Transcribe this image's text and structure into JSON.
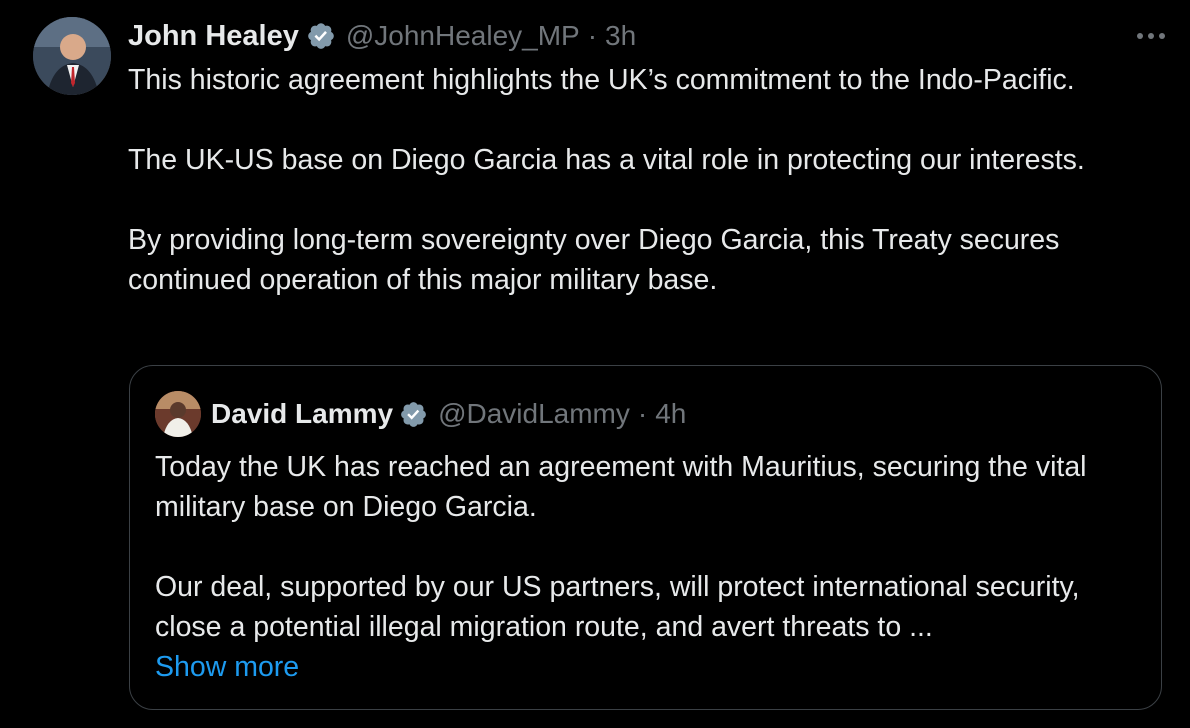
{
  "tweet": {
    "author": {
      "name": "John Healey",
      "handle": "@JohnHealey_MP",
      "separator": "·",
      "time": "3h",
      "verified": true
    },
    "paragraphs": [
      "This historic agreement highlights the UK’s commitment to the Indo-Pacific.",
      "The UK-US base on Diego Garcia has a vital role in protecting our interests.",
      "By providing long-term sovereignty over Diego Garcia, this Treaty secures continued operation of this major military base."
    ],
    "more_icon": "more-horizontal-icon"
  },
  "quoted_tweet": {
    "author": {
      "name": "David Lammy",
      "handle": "@DavidLammy",
      "separator": "·",
      "time": "4h",
      "verified": true
    },
    "paragraphs": [
      "Today the UK has reached an agreement with Mauritius, securing the vital military base on Diego Garcia.",
      "Our deal, supported by our US partners, will protect international security, close a potential illegal migration route, and avert threats to ..."
    ],
    "show_more_label": "Show more"
  },
  "colors": {
    "background": "#000000",
    "text": "#e7e9ea",
    "muted": "#71767b",
    "link": "#1d9bf0",
    "verified_badge": "#829aab",
    "quote_border": "#3b4045"
  }
}
